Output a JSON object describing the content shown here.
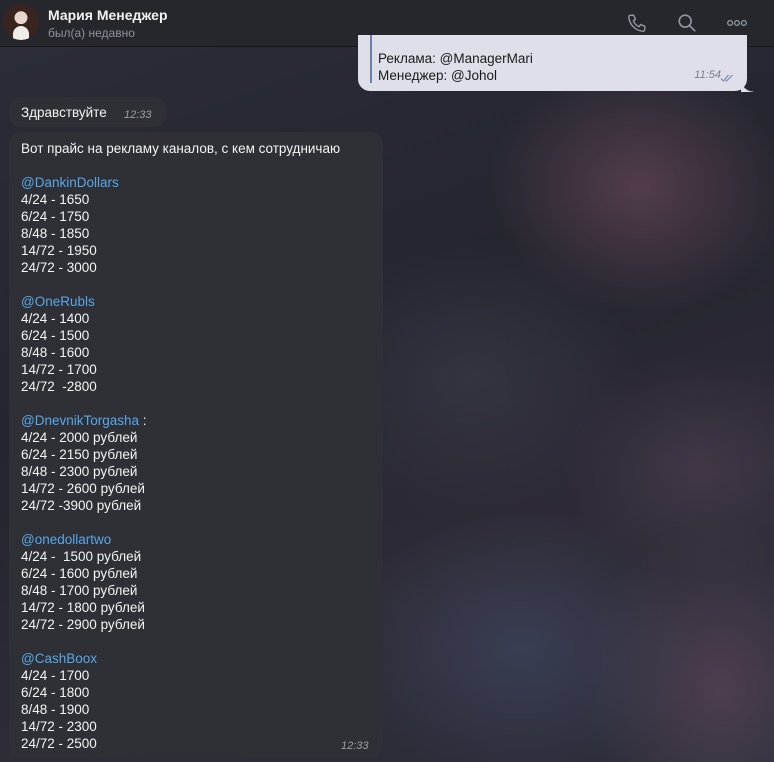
{
  "header": {
    "name": "Мария Менеджер",
    "status": "был(а) недавно"
  },
  "outgoing": {
    "lines": [
      "Реклама: @ManagerMari",
      "Менеджер: @Johol"
    ],
    "time": "11:54"
  },
  "hello": {
    "text": "Здравствуйте",
    "time": "12:33"
  },
  "price": {
    "intro": "Вот прайс на рекламу каналов, с кем сотрудничаю",
    "time": "12:33",
    "channels": [
      {
        "handle": "@DankinDollars",
        "suffix": "",
        "rows": [
          "4/24 - 1650",
          "6/24 - 1750",
          "8/48 - 1850",
          "14/72 - 1950",
          "24/72 - 3000"
        ]
      },
      {
        "handle": "@OneRubls",
        "suffix": "",
        "rows": [
          "4/24 - 1400",
          "6/24 - 1500",
          "8/48 - 1600",
          "14/72 - 1700",
          "24/72  -2800"
        ]
      },
      {
        "handle": "@DnevnikTorgasha",
        "suffix": " :",
        "rows": [
          "4/24 - 2000 рублей",
          "6/24 - 2150 рублей",
          "8/48 - 2300 рублей",
          "14/72 - 2600 рублей",
          "24/72 -3900 рублей"
        ]
      },
      {
        "handle": "@onedollartwo",
        "suffix": "",
        "rows": [
          "4/24 -  1500 рублей",
          "6/24 - 1600 рублей",
          "8/48 - 1700 рублей",
          "14/72 - 1800 рублей",
          "24/72 - 2900 рублей"
        ]
      },
      {
        "handle": "@CashBoox",
        "suffix": "",
        "rows": [
          "4/24 - 1700",
          "6/24 - 1800",
          "8/48 - 1900",
          "14/72 - 2300",
          "24/72 - 2500"
        ]
      }
    ]
  }
}
